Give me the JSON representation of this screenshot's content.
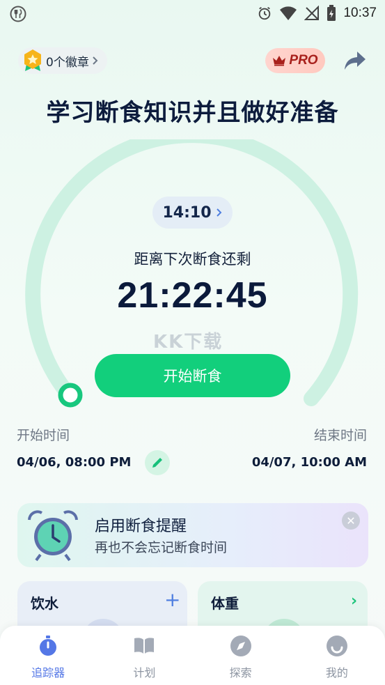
{
  "status_bar": {
    "time": "10:37"
  },
  "header": {
    "badge_label": "0个徽章",
    "pro_label": "PRO",
    "title": "学习断食知识并且做好准备"
  },
  "timer": {
    "plan_chip": "14:10",
    "remaining_label": "距离下次断食还剩",
    "countdown": "21:22:45",
    "start_button_label": "开始断食",
    "watermark": "KK下载"
  },
  "schedule": {
    "start_label": "开始时间",
    "start_value": "04/06, 08:00 PM",
    "end_label": "结束时间",
    "end_value": "04/07, 10:00 AM"
  },
  "reminder": {
    "title": "启用断食提醒",
    "subtitle": "再也不会忘记断食时间"
  },
  "cards": {
    "water_title": "饮水",
    "weight_title": "体重"
  },
  "nav": [
    {
      "label": "追踪器",
      "icon": "stopwatch-icon",
      "active": true
    },
    {
      "label": "计划",
      "icon": "book-icon",
      "active": false
    },
    {
      "label": "探索",
      "icon": "compass-icon",
      "active": false
    },
    {
      "label": "我的",
      "icon": "smile-icon",
      "active": false
    }
  ],
  "colors": {
    "accent_green": "#12cf7c",
    "ring_track": "#cdf1e2",
    "nav_active": "#5477e6"
  }
}
